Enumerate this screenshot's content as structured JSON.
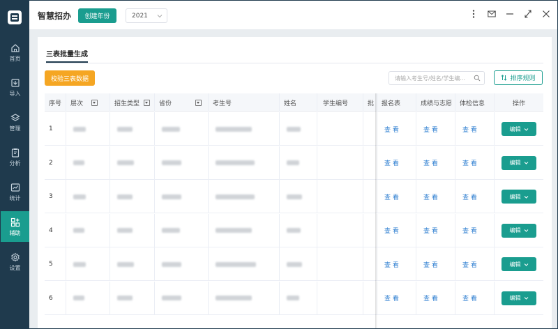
{
  "header": {
    "title": "智慧招办",
    "create_year_label": "创建年份",
    "year_value": "2021"
  },
  "sidebar": {
    "items": [
      {
        "label": "首页",
        "icon": "home-icon",
        "active": false
      },
      {
        "label": "导入",
        "icon": "import-icon",
        "active": false
      },
      {
        "label": "管理",
        "icon": "layers-icon",
        "active": false
      },
      {
        "label": "分析",
        "icon": "clipboard-icon",
        "active": false
      },
      {
        "label": "统计",
        "icon": "chart-icon",
        "active": false
      },
      {
        "label": "辅助",
        "icon": "grid-plus-icon",
        "active": true
      },
      {
        "label": "设置",
        "icon": "gear-icon",
        "active": false
      }
    ]
  },
  "page": {
    "title": "三表批量生成",
    "verify_button": "校验三表数据",
    "search_placeholder": "请输入考生号/姓名/学生编...",
    "sort_button": "排序规则"
  },
  "table": {
    "columns": [
      "序号",
      "层次",
      "招生类型",
      "省份",
      "考生号",
      "姓名",
      "学生编号",
      "批",
      "报名表",
      "成绩与志愿",
      "体检信息",
      "操作"
    ],
    "rows": [
      {
        "index": "1",
        "reg_link": "查 看",
        "score_link": "查 看",
        "health_link": "查 看",
        "edit": "编辑"
      },
      {
        "index": "2",
        "reg_link": "查 看",
        "score_link": "查 看",
        "health_link": "查 看",
        "edit": "编辑"
      },
      {
        "index": "3",
        "reg_link": "查 看",
        "score_link": "查 看",
        "health_link": "查 看",
        "edit": "编辑"
      },
      {
        "index": "4",
        "reg_link": "查 看",
        "score_link": "查 看",
        "health_link": "查 看",
        "edit": "编辑"
      },
      {
        "index": "5",
        "reg_link": "查 看",
        "score_link": "查 看",
        "health_link": "查 看",
        "edit": "编辑"
      },
      {
        "index": "6",
        "reg_link": "查 看",
        "score_link": "查 看",
        "health_link": "查 看",
        "edit": "编辑"
      }
    ]
  },
  "colors": {
    "sidebar_bg": "#1f3a4d",
    "accent": "#1a9d8f",
    "warning": "#f5a623",
    "link": "#2f7fd1"
  }
}
